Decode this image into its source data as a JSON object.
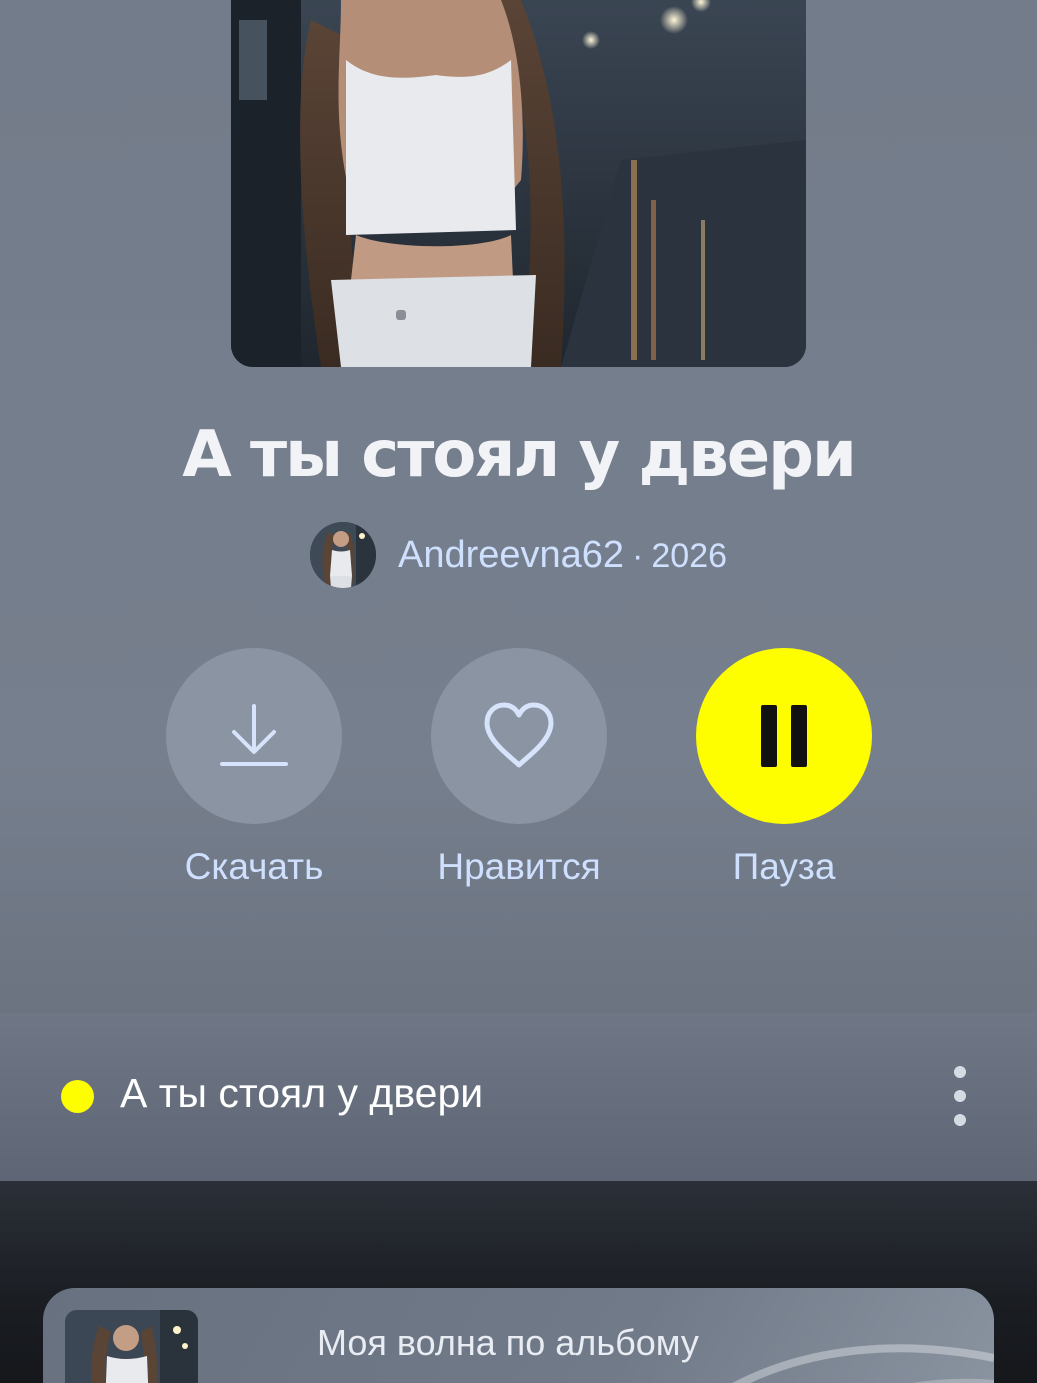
{
  "track": {
    "title": "А ты стоял у двери",
    "artist": "Andreevna62",
    "separator": "·",
    "year": "2026"
  },
  "actions": {
    "download_label": "Скачать",
    "like_label": "Нравится",
    "pause_label": "Пауза"
  },
  "tracklist": {
    "items": [
      {
        "title": "А ты стоял у двери",
        "playing": true
      }
    ]
  },
  "mini_player": {
    "caption": "Моя волна по альбому"
  },
  "icons": {
    "download": "download-icon",
    "like": "heart-icon",
    "pause": "pause-icon",
    "more": "more-vertical-icon",
    "playing": "now-playing-dot"
  },
  "colors": {
    "accent": "#fefe00",
    "background": "#767f8d",
    "button": "#8a94a3",
    "link_text": "#cfe0ff"
  }
}
